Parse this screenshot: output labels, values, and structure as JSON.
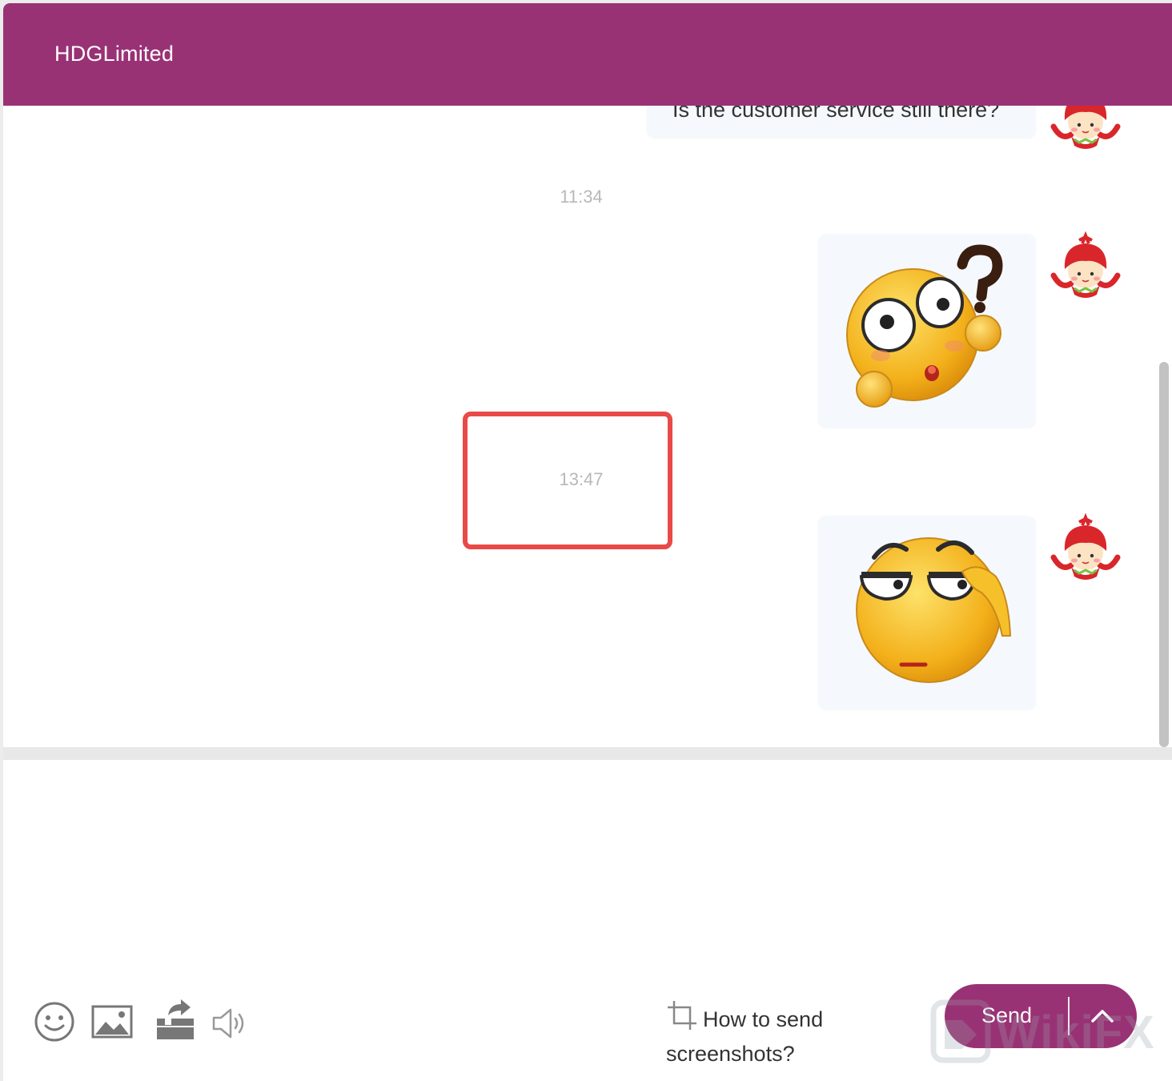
{
  "header": {
    "title": "HDGLimited"
  },
  "messages": {
    "partial_text": "Is the customer service still there?",
    "timestamp_1": "11:34",
    "timestamp_2": "13:47"
  },
  "toolbar": {
    "icons": [
      "smiley-icon",
      "image-icon",
      "share-file-icon",
      "speaker-icon"
    ]
  },
  "help": {
    "how_to_send_screenshots": "How to send screenshots?"
  },
  "send": {
    "label": "Send"
  },
  "watermark": {
    "text": "WikiFX"
  },
  "colors": {
    "brand": "#993275",
    "highlight": "#e94a47",
    "bubble": "#f5f9fd"
  }
}
